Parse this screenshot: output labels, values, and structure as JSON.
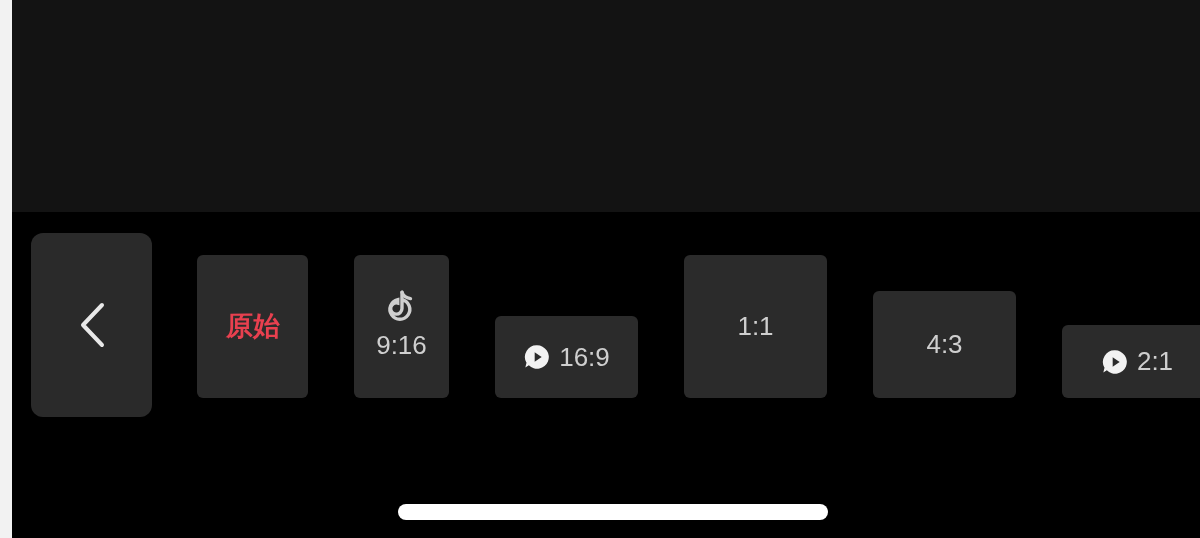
{
  "aspect_options": [
    {
      "label": "原始",
      "kind": "plain",
      "selected": true
    },
    {
      "label": "9:16",
      "kind": "note",
      "selected": false
    },
    {
      "label": "16:9",
      "kind": "play",
      "selected": false
    },
    {
      "label": "1:1",
      "kind": "plain",
      "selected": false
    },
    {
      "label": "4:3",
      "kind": "plain",
      "selected": false
    },
    {
      "label": "2:1",
      "kind": "play",
      "selected": false
    }
  ]
}
